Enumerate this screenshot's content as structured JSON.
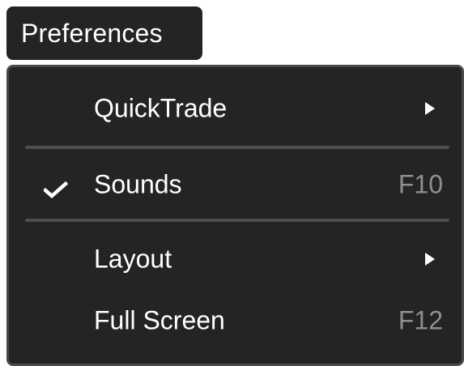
{
  "menu": {
    "title": "Preferences",
    "items": [
      {
        "label": "QuickTrade",
        "shortcut": "",
        "submenu": true,
        "checked": false
      },
      {
        "label": "Sounds",
        "shortcut": "F10",
        "submenu": false,
        "checked": true
      },
      {
        "label": "Layout",
        "shortcut": "",
        "submenu": true,
        "checked": false
      },
      {
        "label": "Full Screen",
        "shortcut": "F12",
        "submenu": false,
        "checked": false
      }
    ],
    "icons": {
      "check": "checkmark-icon",
      "submenu": "triangle-right-icon"
    },
    "colors": {
      "menu_background": "#242424",
      "separator": "#4e4e4e",
      "shortcut_text": "#8f8f8f",
      "label_text": "#ffffff"
    }
  }
}
